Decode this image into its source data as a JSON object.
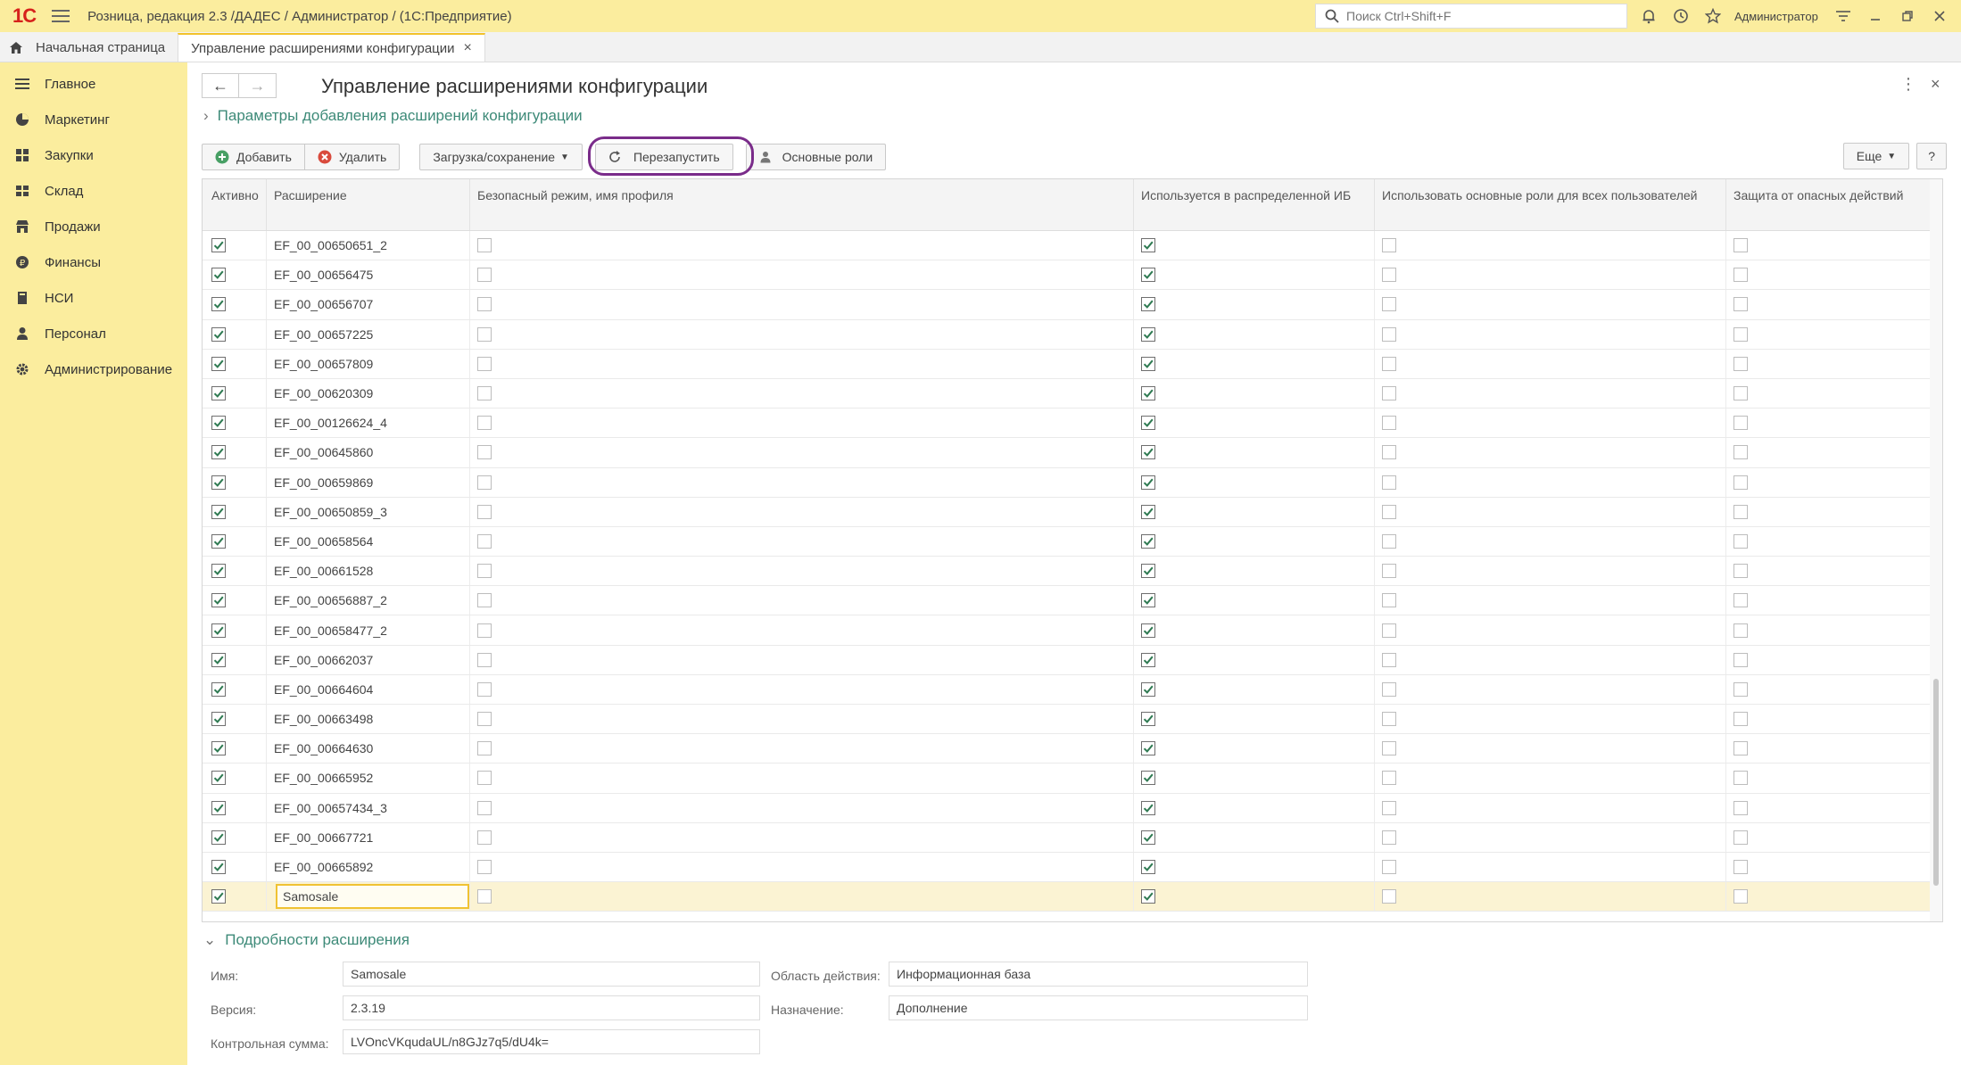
{
  "app": {
    "logo": "1С",
    "title": "Розница, редакция 2.3 /ДАДЕС / Администратор /  (1С:Предприятие)",
    "search_placeholder": "Поиск Ctrl+Shift+F",
    "user": "Администратор"
  },
  "tabs": {
    "home": "Начальная страница",
    "active": "Управление расширениями конфигурации",
    "close": "×"
  },
  "sidebar": {
    "items": [
      {
        "label": "Главное"
      },
      {
        "label": "Маркетинг"
      },
      {
        "label": "Закупки"
      },
      {
        "label": "Склад"
      },
      {
        "label": "Продажи"
      },
      {
        "label": "Финансы"
      },
      {
        "label": "НСИ"
      },
      {
        "label": "Персонал"
      },
      {
        "label": "Администрирование"
      }
    ]
  },
  "form": {
    "title": "Управление расширениями конфигурации",
    "params_link": "Параметры добавления расширений конфигурации",
    "back": "←",
    "forward": "→"
  },
  "toolbar": {
    "add": "Добавить",
    "delete": "Удалить",
    "load_save": "Загрузка/сохранение",
    "restart": "Перезапустить",
    "roles": "Основные роли",
    "more": "Еще",
    "help": "?"
  },
  "table": {
    "columns": [
      "Активно",
      "Расширение",
      "Безопасный режим, имя профиля",
      "Используется в распределенной ИБ",
      "Использовать основные роли для всех пользователей",
      "Защита от опасных действий"
    ],
    "rows": [
      {
        "active": true,
        "name": "EF_00_00650651_2",
        "safe": false,
        "dist": true,
        "roles": false,
        "protect": false
      },
      {
        "active": true,
        "name": "EF_00_00656475",
        "safe": false,
        "dist": true,
        "roles": false,
        "protect": false
      },
      {
        "active": true,
        "name": "EF_00_00656707",
        "safe": false,
        "dist": true,
        "roles": false,
        "protect": false
      },
      {
        "active": true,
        "name": "EF_00_00657225",
        "safe": false,
        "dist": true,
        "roles": false,
        "protect": false
      },
      {
        "active": true,
        "name": "EF_00_00657809",
        "safe": false,
        "dist": true,
        "roles": false,
        "protect": false
      },
      {
        "active": true,
        "name": "EF_00_00620309",
        "safe": false,
        "dist": true,
        "roles": false,
        "protect": false
      },
      {
        "active": true,
        "name": "EF_00_00126624_4",
        "safe": false,
        "dist": true,
        "roles": false,
        "protect": false
      },
      {
        "active": true,
        "name": "EF_00_00645860",
        "safe": false,
        "dist": true,
        "roles": false,
        "protect": false
      },
      {
        "active": true,
        "name": "EF_00_00659869",
        "safe": false,
        "dist": true,
        "roles": false,
        "protect": false
      },
      {
        "active": true,
        "name": "EF_00_00650859_3",
        "safe": false,
        "dist": true,
        "roles": false,
        "protect": false
      },
      {
        "active": true,
        "name": "EF_00_00658564",
        "safe": false,
        "dist": true,
        "roles": false,
        "protect": false
      },
      {
        "active": true,
        "name": "EF_00_00661528",
        "safe": false,
        "dist": true,
        "roles": false,
        "protect": false
      },
      {
        "active": true,
        "name": "EF_00_00656887_2",
        "safe": false,
        "dist": true,
        "roles": false,
        "protect": false
      },
      {
        "active": true,
        "name": "EF_00_00658477_2",
        "safe": false,
        "dist": true,
        "roles": false,
        "protect": false
      },
      {
        "active": true,
        "name": "EF_00_00662037",
        "safe": false,
        "dist": true,
        "roles": false,
        "protect": false
      },
      {
        "active": true,
        "name": "EF_00_00664604",
        "safe": false,
        "dist": true,
        "roles": false,
        "protect": false
      },
      {
        "active": true,
        "name": "EF_00_00663498",
        "safe": false,
        "dist": true,
        "roles": false,
        "protect": false
      },
      {
        "active": true,
        "name": "EF_00_00664630",
        "safe": false,
        "dist": true,
        "roles": false,
        "protect": false
      },
      {
        "active": true,
        "name": "EF_00_00665952",
        "safe": false,
        "dist": true,
        "roles": false,
        "protect": false
      },
      {
        "active": true,
        "name": "EF_00_00657434_3",
        "safe": false,
        "dist": true,
        "roles": false,
        "protect": false
      },
      {
        "active": true,
        "name": "EF_00_00667721",
        "safe": false,
        "dist": true,
        "roles": false,
        "protect": false
      },
      {
        "active": true,
        "name": "EF_00_00665892",
        "safe": false,
        "dist": true,
        "roles": false,
        "protect": false
      },
      {
        "active": true,
        "name": "Samosale",
        "safe": false,
        "dist": true,
        "roles": false,
        "protect": false,
        "selected": true
      }
    ]
  },
  "details": {
    "title": "Подробности расширения",
    "name_label": "Имя:",
    "name_value": "Samosale",
    "version_label": "Версия:",
    "version_value": "2.3.19",
    "checksum_label": "Контрольная сумма:",
    "checksum_value": "LVOncVKqudaUL/n8GJz7q5/dU4k=",
    "scope_label": "Область действия:",
    "scope_value": "Информационная база",
    "purpose_label": "Назначение:",
    "purpose_value": "Дополнение"
  },
  "colors": {
    "chrome_yellow": "#fbed9e",
    "accent_green": "#3d8a78",
    "highlight_ring": "#7a2c8a",
    "logo_red": "#d6221c"
  }
}
